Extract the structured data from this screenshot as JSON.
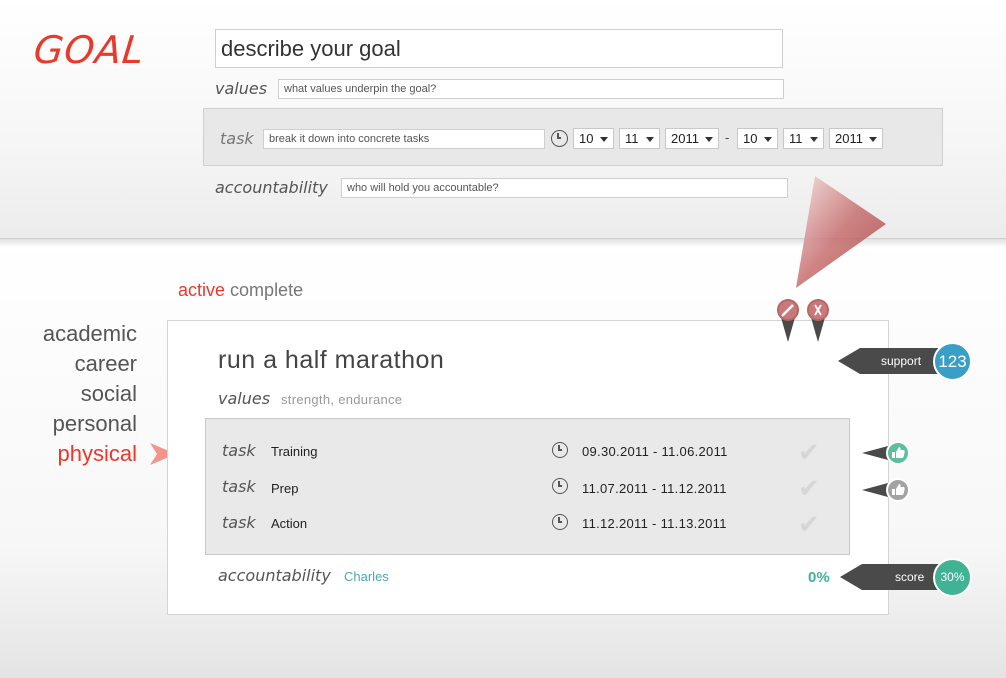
{
  "logo": "GOAL",
  "form": {
    "goal_placeholder": "describe your goal",
    "values_label": "values",
    "values_placeholder": "what values underpin the goal?",
    "task_label": "task",
    "task_placeholder": "break it down into concrete tasks",
    "start": {
      "month": "10",
      "day": "11",
      "year": "2011"
    },
    "date_separator": "-",
    "end": {
      "month": "10",
      "day": "11",
      "year": "2011"
    },
    "accountability_label": "accountability",
    "accountability_placeholder": "who will hold you accountable?"
  },
  "tabs": {
    "active": "active",
    "complete": "complete"
  },
  "categories": [
    "academic",
    "career",
    "social",
    "personal",
    "physical"
  ],
  "selected_category": "physical",
  "goal": {
    "title": "run a half marathon",
    "values_label": "values",
    "values": "strength, endurance",
    "tasks": [
      {
        "label": "task",
        "name": "Training",
        "dates": "09.30.2011 - 11.06.2011"
      },
      {
        "label": "task",
        "name": "Prep",
        "dates": "11.07.2011 - 11.12.2011"
      },
      {
        "label": "task",
        "name": "Action",
        "dates": "11.12.2011 - 11.13.2011"
      }
    ],
    "accountability_label": "accountability",
    "accountability_person": "Charles",
    "progress": "0%"
  },
  "support": {
    "label": "support",
    "count": "123"
  },
  "score": {
    "label": "score",
    "value": "30%"
  },
  "icons": {
    "edit": "pencil-icon",
    "delete": "x-icon",
    "clock": "clock-icon",
    "check": "check-icon",
    "thumbs_up": "thumbs-up-icon",
    "pointer": "arrow-pointer-icon"
  },
  "colors": {
    "accent_red": "#e8392a",
    "support_blue": "#3a9fc6",
    "score_green": "#3fb393",
    "link_teal": "#4aa7b7",
    "flag_dark": "#4a4a4a"
  }
}
